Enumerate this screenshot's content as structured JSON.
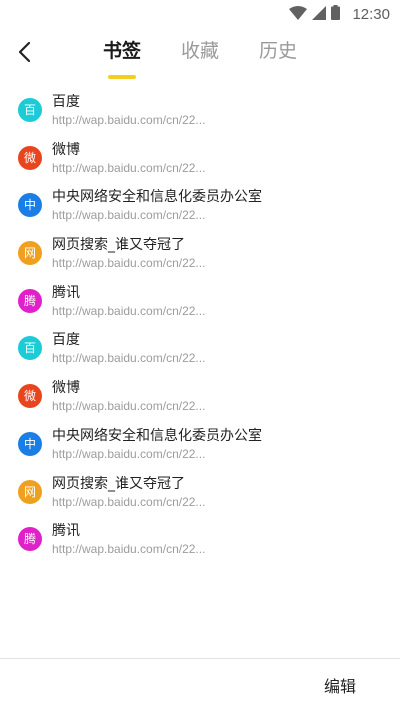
{
  "status_bar": {
    "time": "12:30",
    "icons": [
      "wifi-icon",
      "cellular-signal-icon",
      "battery-icon"
    ]
  },
  "header": {
    "back_icon": "back-arrow-icon",
    "tabs": [
      {
        "label": "书签",
        "active": true
      },
      {
        "label": "收藏",
        "active": false
      },
      {
        "label": "历史",
        "active": false
      }
    ],
    "accent_color": "#f5cf1f"
  },
  "bookmarks": [
    {
      "icon_char": "百",
      "icon_color": "#1ccbd6",
      "title": "百度",
      "url": "http://wap.baidu.com/cn/22..."
    },
    {
      "icon_char": "微",
      "icon_color": "#e8451e",
      "title": "微博",
      "url": "http://wap.baidu.com/cn/22..."
    },
    {
      "icon_char": "中",
      "icon_color": "#1a7ee6",
      "title": "中央网络安全和信息化委员办公室",
      "url": "http://wap.baidu.com/cn/22..."
    },
    {
      "icon_char": "网",
      "icon_color": "#f0a020",
      "title": "网页搜索_谁又夺冠了",
      "url": "http://wap.baidu.com/cn/22..."
    },
    {
      "icon_char": "腾",
      "icon_color": "#e020c8",
      "title": "腾讯",
      "url": "http://wap.baidu.com/cn/22..."
    },
    {
      "icon_char": "百",
      "icon_color": "#1ccbd6",
      "title": "百度",
      "url": "http://wap.baidu.com/cn/22..."
    },
    {
      "icon_char": "微",
      "icon_color": "#e8451e",
      "title": "微博",
      "url": "http://wap.baidu.com/cn/22..."
    },
    {
      "icon_char": "中",
      "icon_color": "#1a7ee6",
      "title": "中央网络安全和信息化委员办公室",
      "url": "http://wap.baidu.com/cn/22..."
    },
    {
      "icon_char": "网",
      "icon_color": "#f0a020",
      "title": "网页搜索_谁又夺冠了",
      "url": "http://wap.baidu.com/cn/22..."
    },
    {
      "icon_char": "腾",
      "icon_color": "#e020c8",
      "title": "腾讯",
      "url": "http://wap.baidu.com/cn/22..."
    }
  ],
  "bottom_bar": {
    "edit_label": "编辑"
  }
}
